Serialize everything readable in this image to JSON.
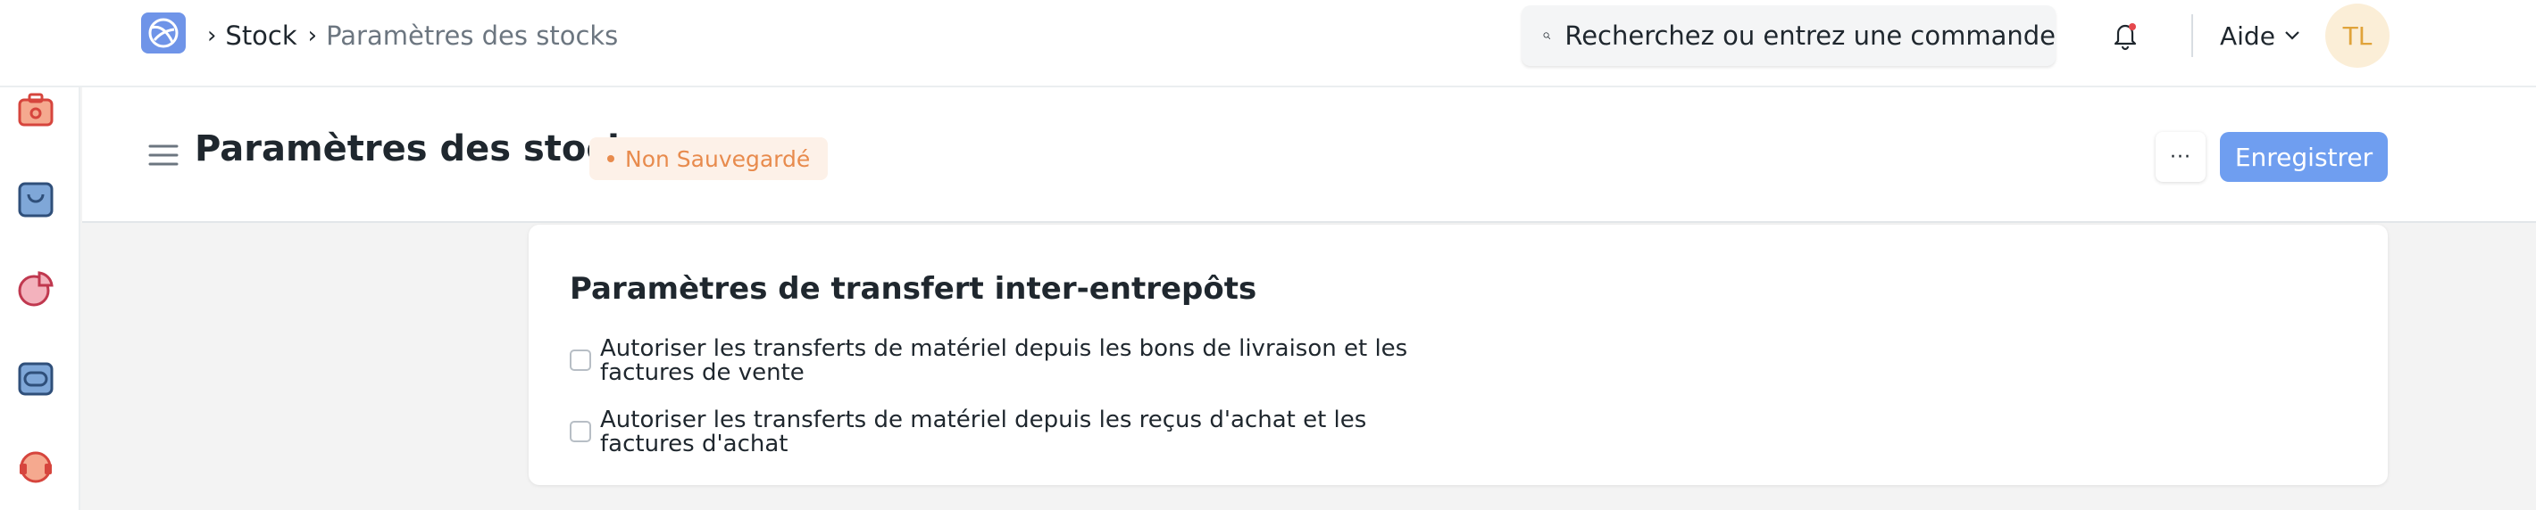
{
  "navbar": {
    "breadcrumbs": [
      "Stock",
      "Paramètres des stocks"
    ],
    "search_placeholder": "Recherchez ou entrez une commande",
    "help_label": "Aide",
    "avatar_initials": "TL"
  },
  "sidebar": {
    "icons": [
      "toolbox-icon",
      "shopping-bag-icon",
      "pie-chart-icon",
      "wallet-icon",
      "support-icon"
    ]
  },
  "page": {
    "title": "Paramètres des stocks",
    "status": "Non Sauvegardé",
    "more_label": "···",
    "save_label": "Enregistrer"
  },
  "section": {
    "title": "Paramètres de transfert inter-entrepôts",
    "options": [
      {
        "label": "Autoriser les transferts de matériel depuis les bons de livraison et les factures de vente",
        "checked": false
      },
      {
        "label": "Autoriser les transferts de matériel depuis les reçus d'achat et les factures d'achat",
        "checked": false
      }
    ]
  },
  "colors": {
    "accent": "#6f9ef0",
    "status": "#e88b4d",
    "avatar_bg": "#fbeed7"
  }
}
